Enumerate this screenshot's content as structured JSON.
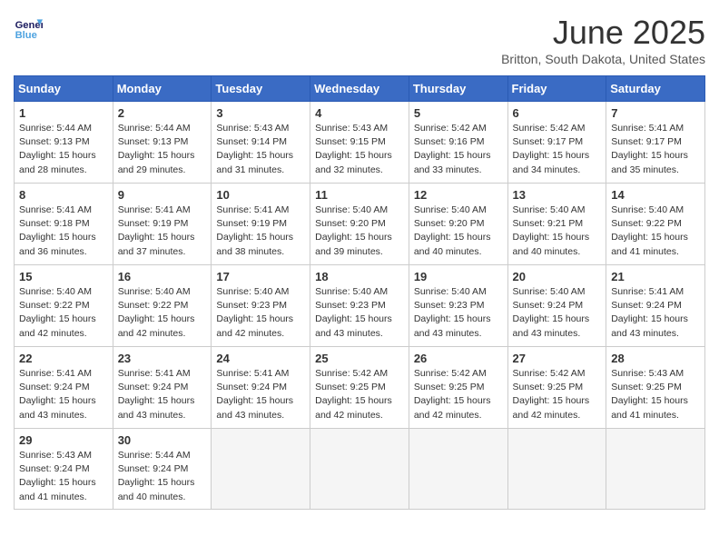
{
  "header": {
    "logo_line1": "General",
    "logo_line2": "Blue",
    "month_title": "June 2025",
    "location": "Britton, South Dakota, United States"
  },
  "days_of_week": [
    "Sunday",
    "Monday",
    "Tuesday",
    "Wednesday",
    "Thursday",
    "Friday",
    "Saturday"
  ],
  "weeks": [
    [
      {
        "day": "1",
        "sunrise": "5:44 AM",
        "sunset": "9:13 PM",
        "daylight": "15 hours and 28 minutes."
      },
      {
        "day": "2",
        "sunrise": "5:44 AM",
        "sunset": "9:13 PM",
        "daylight": "15 hours and 29 minutes."
      },
      {
        "day": "3",
        "sunrise": "5:43 AM",
        "sunset": "9:14 PM",
        "daylight": "15 hours and 31 minutes."
      },
      {
        "day": "4",
        "sunrise": "5:43 AM",
        "sunset": "9:15 PM",
        "daylight": "15 hours and 32 minutes."
      },
      {
        "day": "5",
        "sunrise": "5:42 AM",
        "sunset": "9:16 PM",
        "daylight": "15 hours and 33 minutes."
      },
      {
        "day": "6",
        "sunrise": "5:42 AM",
        "sunset": "9:17 PM",
        "daylight": "15 hours and 34 minutes."
      },
      {
        "day": "7",
        "sunrise": "5:41 AM",
        "sunset": "9:17 PM",
        "daylight": "15 hours and 35 minutes."
      }
    ],
    [
      {
        "day": "8",
        "sunrise": "5:41 AM",
        "sunset": "9:18 PM",
        "daylight": "15 hours and 36 minutes."
      },
      {
        "day": "9",
        "sunrise": "5:41 AM",
        "sunset": "9:19 PM",
        "daylight": "15 hours and 37 minutes."
      },
      {
        "day": "10",
        "sunrise": "5:41 AM",
        "sunset": "9:19 PM",
        "daylight": "15 hours and 38 minutes."
      },
      {
        "day": "11",
        "sunrise": "5:40 AM",
        "sunset": "9:20 PM",
        "daylight": "15 hours and 39 minutes."
      },
      {
        "day": "12",
        "sunrise": "5:40 AM",
        "sunset": "9:20 PM",
        "daylight": "15 hours and 40 minutes."
      },
      {
        "day": "13",
        "sunrise": "5:40 AM",
        "sunset": "9:21 PM",
        "daylight": "15 hours and 40 minutes."
      },
      {
        "day": "14",
        "sunrise": "5:40 AM",
        "sunset": "9:22 PM",
        "daylight": "15 hours and 41 minutes."
      }
    ],
    [
      {
        "day": "15",
        "sunrise": "5:40 AM",
        "sunset": "9:22 PM",
        "daylight": "15 hours and 42 minutes."
      },
      {
        "day": "16",
        "sunrise": "5:40 AM",
        "sunset": "9:22 PM",
        "daylight": "15 hours and 42 minutes."
      },
      {
        "day": "17",
        "sunrise": "5:40 AM",
        "sunset": "9:23 PM",
        "daylight": "15 hours and 42 minutes."
      },
      {
        "day": "18",
        "sunrise": "5:40 AM",
        "sunset": "9:23 PM",
        "daylight": "15 hours and 43 minutes."
      },
      {
        "day": "19",
        "sunrise": "5:40 AM",
        "sunset": "9:23 PM",
        "daylight": "15 hours and 43 minutes."
      },
      {
        "day": "20",
        "sunrise": "5:40 AM",
        "sunset": "9:24 PM",
        "daylight": "15 hours and 43 minutes."
      },
      {
        "day": "21",
        "sunrise": "5:41 AM",
        "sunset": "9:24 PM",
        "daylight": "15 hours and 43 minutes."
      }
    ],
    [
      {
        "day": "22",
        "sunrise": "5:41 AM",
        "sunset": "9:24 PM",
        "daylight": "15 hours and 43 minutes."
      },
      {
        "day": "23",
        "sunrise": "5:41 AM",
        "sunset": "9:24 PM",
        "daylight": "15 hours and 43 minutes."
      },
      {
        "day": "24",
        "sunrise": "5:41 AM",
        "sunset": "9:24 PM",
        "daylight": "15 hours and 43 minutes."
      },
      {
        "day": "25",
        "sunrise": "5:42 AM",
        "sunset": "9:25 PM",
        "daylight": "15 hours and 42 minutes."
      },
      {
        "day": "26",
        "sunrise": "5:42 AM",
        "sunset": "9:25 PM",
        "daylight": "15 hours and 42 minutes."
      },
      {
        "day": "27",
        "sunrise": "5:42 AM",
        "sunset": "9:25 PM",
        "daylight": "15 hours and 42 minutes."
      },
      {
        "day": "28",
        "sunrise": "5:43 AM",
        "sunset": "9:25 PM",
        "daylight": "15 hours and 41 minutes."
      }
    ],
    [
      {
        "day": "29",
        "sunrise": "5:43 AM",
        "sunset": "9:24 PM",
        "daylight": "15 hours and 41 minutes."
      },
      {
        "day": "30",
        "sunrise": "5:44 AM",
        "sunset": "9:24 PM",
        "daylight": "15 hours and 40 minutes."
      },
      null,
      null,
      null,
      null,
      null
    ]
  ]
}
